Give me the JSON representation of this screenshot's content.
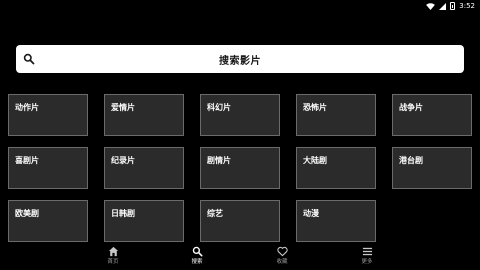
{
  "status_bar": {
    "time": "3:52",
    "icons": [
      "wifi-icon",
      "signal-icon",
      "battery-icon"
    ]
  },
  "search": {
    "placeholder": "搜索影片",
    "icon": "search-icon"
  },
  "categories": [
    "动作片",
    "爱情片",
    "科幻片",
    "恐怖片",
    "战争片",
    "喜剧片",
    "纪录片",
    "剧情片",
    "大陆剧",
    "港台剧",
    "欧美剧",
    "日韩剧",
    "综艺",
    "动漫"
  ],
  "bottom_nav": {
    "items": [
      {
        "label": "首页",
        "icon": "home-icon",
        "active": false
      },
      {
        "label": "搜索",
        "icon": "search-icon",
        "active": true
      },
      {
        "label": "收藏",
        "icon": "heart-icon",
        "active": false
      },
      {
        "label": "更多",
        "icon": "menu-icon",
        "active": false
      }
    ]
  },
  "colors": {
    "background": "#000000",
    "tile": "#2b2b2b",
    "tile_border": "#6a6a6a",
    "search_bg": "#ffffff",
    "nav_inactive": "#9a9a9a"
  }
}
